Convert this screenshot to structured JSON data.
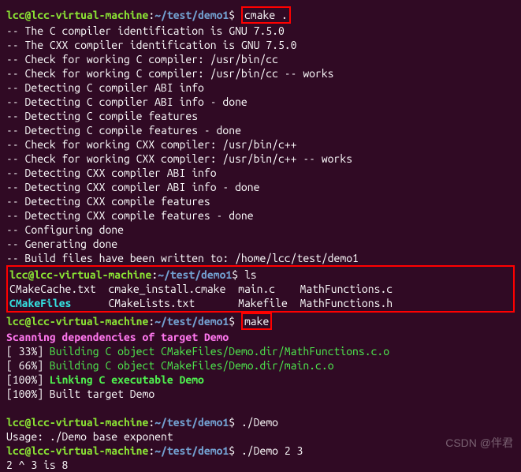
{
  "prompt": {
    "user": "lcc",
    "host": "lcc-virtual-machine",
    "path": "~/test/demo1",
    "sep": "$"
  },
  "cmd1": "cmake .",
  "cmake_out": [
    "-- The C compiler identification is GNU 7.5.0",
    "-- The CXX compiler identification is GNU 7.5.0",
    "-- Check for working C compiler: /usr/bin/cc",
    "-- Check for working C compiler: /usr/bin/cc -- works",
    "-- Detecting C compiler ABI info",
    "-- Detecting C compiler ABI info - done",
    "-- Detecting C compile features",
    "-- Detecting C compile features - done",
    "-- Check for working CXX compiler: /usr/bin/c++",
    "-- Check for working CXX compiler: /usr/bin/c++ -- works",
    "-- Detecting CXX compiler ABI info",
    "-- Detecting CXX compiler ABI info - done",
    "-- Detecting CXX compile features",
    "-- Detecting CXX compile features - done",
    "-- Configuring done",
    "-- Generating done",
    "-- Build files have been written to: /home/lcc/test/demo1"
  ],
  "cmd2": "ls",
  "ls_out": {
    "row1": {
      "c1": "CMakeCache.txt",
      "c2": "cmake_install.cmake",
      "c3": "main.c",
      "c4": "MathFunctions.c"
    },
    "row2": {
      "c1": "CMakeFiles",
      "c2": "CMakeLists.txt",
      "c3": "Makefile",
      "c4": "MathFunctions.h"
    }
  },
  "cmd3": "make",
  "make_out": {
    "scan": "Scanning dependencies of target Demo",
    "p33": "[ 33%] ",
    "b33": "Building C object CMakeFiles/Demo.dir/MathFunctions.c.o",
    "p66": "[ 66%] ",
    "b66": "Building C object CMakeFiles/Demo.dir/main.c.o",
    "p100a": "[100%] ",
    "link": "Linking C executable Demo",
    "p100b": "[100%] Built target Demo"
  },
  "cmd4": "./Demo",
  "usage": "Usage: ./Demo base exponent",
  "cmd5": "./Demo 2 3",
  "result": "2 ^ 3 is 8",
  "watermark": "CSDN @伴君"
}
